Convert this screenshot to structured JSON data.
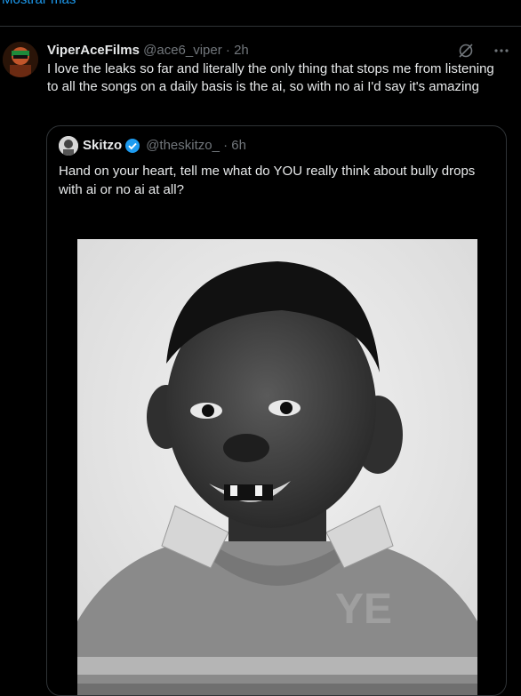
{
  "top": {
    "show_more": "Mostrar más"
  },
  "reply": {
    "name": "ViperAceFilms",
    "handle": "@ace6_viper",
    "separator": "·",
    "time": "2h",
    "text": "I love the leaks so far and literally the only thing that stops me from listening to all the songs on a daily basis is the ai, so with no ai I'd say it's amazing"
  },
  "quote": {
    "name": "Skitzo",
    "handle": "@theskitzo_",
    "separator": "·",
    "time": "6h",
    "text": "Hand on your heart, tell me what do YOU really think about bully drops with ai or no ai at all?",
    "image_watermark": "YE"
  },
  "icons": {
    "grok": "grok-icon",
    "more": "more-icon",
    "verified": "verified-badge-icon"
  },
  "colors": {
    "background": "#000000",
    "link": "#1d9bf0",
    "muted": "#71767b",
    "border": "#2f3336",
    "verified": "#1d9bf0"
  }
}
